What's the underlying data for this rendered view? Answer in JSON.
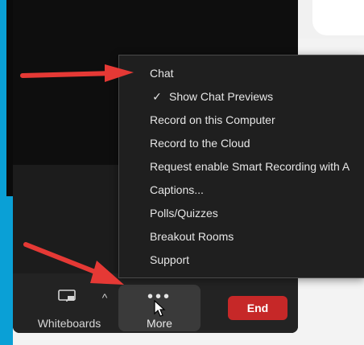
{
  "menu": {
    "items": [
      {
        "label": "Chat"
      },
      {
        "label": "Show Chat Previews",
        "checked": true,
        "check_icon": "check-icon"
      },
      {
        "label": "Record on this Computer"
      },
      {
        "label": "Record to the Cloud"
      },
      {
        "label": "Request enable Smart Recording with A"
      },
      {
        "label": "Captions..."
      },
      {
        "label": "Polls/Quizzes"
      },
      {
        "label": "Breakout Rooms"
      },
      {
        "label": "Support"
      }
    ]
  },
  "toolbar": {
    "whiteboards_label": "Whiteboards",
    "more_label": "More",
    "end_label": "End",
    "more_icon": "ellipsis-icon",
    "caret_icon": "chevron-up-icon"
  },
  "colors": {
    "accent_frame": "#0aa0d6",
    "end_button": "#c62828",
    "arrow": "#e53935",
    "menu_bg": "#1f1f1f"
  }
}
